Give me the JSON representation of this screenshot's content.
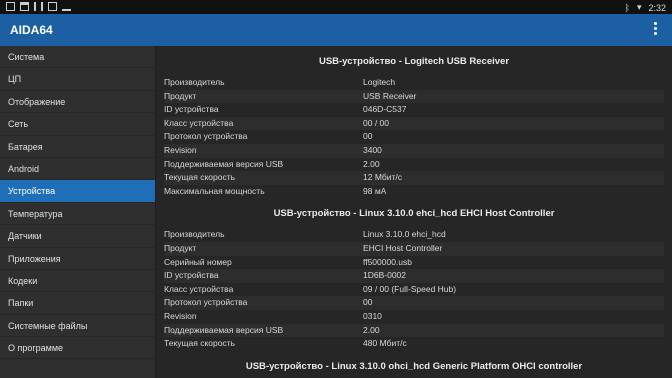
{
  "status": {
    "time": "2:32"
  },
  "app": {
    "title": "AIDA64"
  },
  "sidebar": {
    "items": [
      {
        "label": "Система"
      },
      {
        "label": "ЦП"
      },
      {
        "label": "Отображение"
      },
      {
        "label": "Сеть"
      },
      {
        "label": "Батарея"
      },
      {
        "label": "Android"
      },
      {
        "label": "Устройства"
      },
      {
        "label": "Температура"
      },
      {
        "label": "Датчики"
      },
      {
        "label": "Приложения"
      },
      {
        "label": "Кодеки"
      },
      {
        "label": "Папки"
      },
      {
        "label": "Системные файлы"
      },
      {
        "label": "О программе"
      }
    ],
    "active_index": 6
  },
  "sections": [
    {
      "title": "USB-устройство - Logitech USB Receiver",
      "rows": [
        {
          "k": "Производитель",
          "v": "Logitech"
        },
        {
          "k": "Продукт",
          "v": "USB Receiver"
        },
        {
          "k": "ID устройства",
          "v": "046D-C537"
        },
        {
          "k": "Класс устройства",
          "v": "00 / 00"
        },
        {
          "k": "Протокол устройства",
          "v": "00"
        },
        {
          "k": "Revision",
          "v": "3400"
        },
        {
          "k": "Поддерживаемая версия USB",
          "v": "2.00"
        },
        {
          "k": "Текущая скорость",
          "v": "12 Мбит/с"
        },
        {
          "k": "Максимальная мощность",
          "v": "98 мА"
        }
      ]
    },
    {
      "title": "USB-устройство - Linux 3.10.0 ehci_hcd EHCI Host Controller",
      "rows": [
        {
          "k": "Производитель",
          "v": "Linux 3.10.0 ehci_hcd"
        },
        {
          "k": "Продукт",
          "v": "EHCI Host Controller"
        },
        {
          "k": "Серийный номер",
          "v": "ff500000.usb"
        },
        {
          "k": "ID устройства",
          "v": "1D6B-0002"
        },
        {
          "k": "Класс устройства",
          "v": "09 / 00 (Full-Speed Hub)"
        },
        {
          "k": "Протокол устройства",
          "v": "00"
        },
        {
          "k": "Revision",
          "v": "0310"
        },
        {
          "k": "Поддерживаемая версия USB",
          "v": "2.00"
        },
        {
          "k": "Текущая скорость",
          "v": "480 Мбит/с"
        }
      ]
    },
    {
      "title": "USB-устройство - Linux 3.10.0 ohci_hcd Generic Platform OHCI controller",
      "rows": []
    }
  ]
}
